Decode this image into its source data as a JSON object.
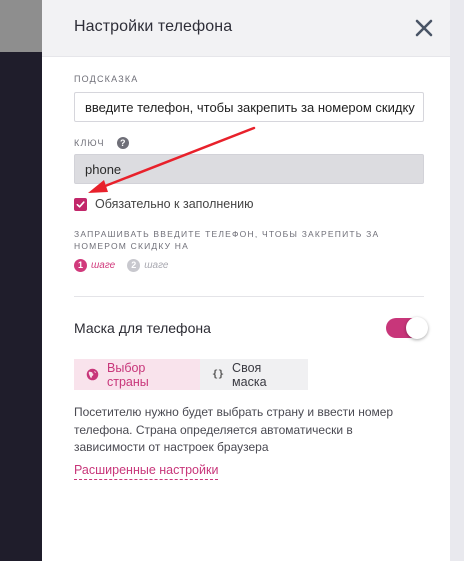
{
  "panel": {
    "title": "Настройки телефона"
  },
  "hint": {
    "label": "ПОДСКАЗКА",
    "value": "введите телефон, чтобы закрепить за номером скидку"
  },
  "key": {
    "label": "КЛЮЧ",
    "help_glyph": "?",
    "value": "phone"
  },
  "required": {
    "checked": true,
    "label": "Обязательно к заполнению"
  },
  "ask": {
    "label": "ЗАПРАШИВАТЬ ВВЕДИТЕ ТЕЛЕФОН, ЧТОБЫ ЗАКРЕПИТЬ ЗА НОМЕРОМ СКИДКУ НА"
  },
  "steps": [
    {
      "number": "1",
      "word": "шаге",
      "active": true
    },
    {
      "number": "2",
      "word": "шаге",
      "active": false
    }
  ],
  "mask": {
    "title": "Маска для телефона",
    "enabled": true,
    "options": [
      {
        "label": "Выбор страны",
        "icon": "globe-icon",
        "selected": true
      },
      {
        "label": "Своя маска",
        "icon": "braces-icon",
        "braces": "{}",
        "selected": false
      }
    ],
    "description": "Посетителю нужно будет выбрать страну и ввести номер телефона. Страна определяется автоматически в зависимости от настроек браузера",
    "advanced_link": "Расширенные настройки"
  },
  "colors": {
    "accent": "#c8367a",
    "annotation_arrow": "#e8212b"
  }
}
